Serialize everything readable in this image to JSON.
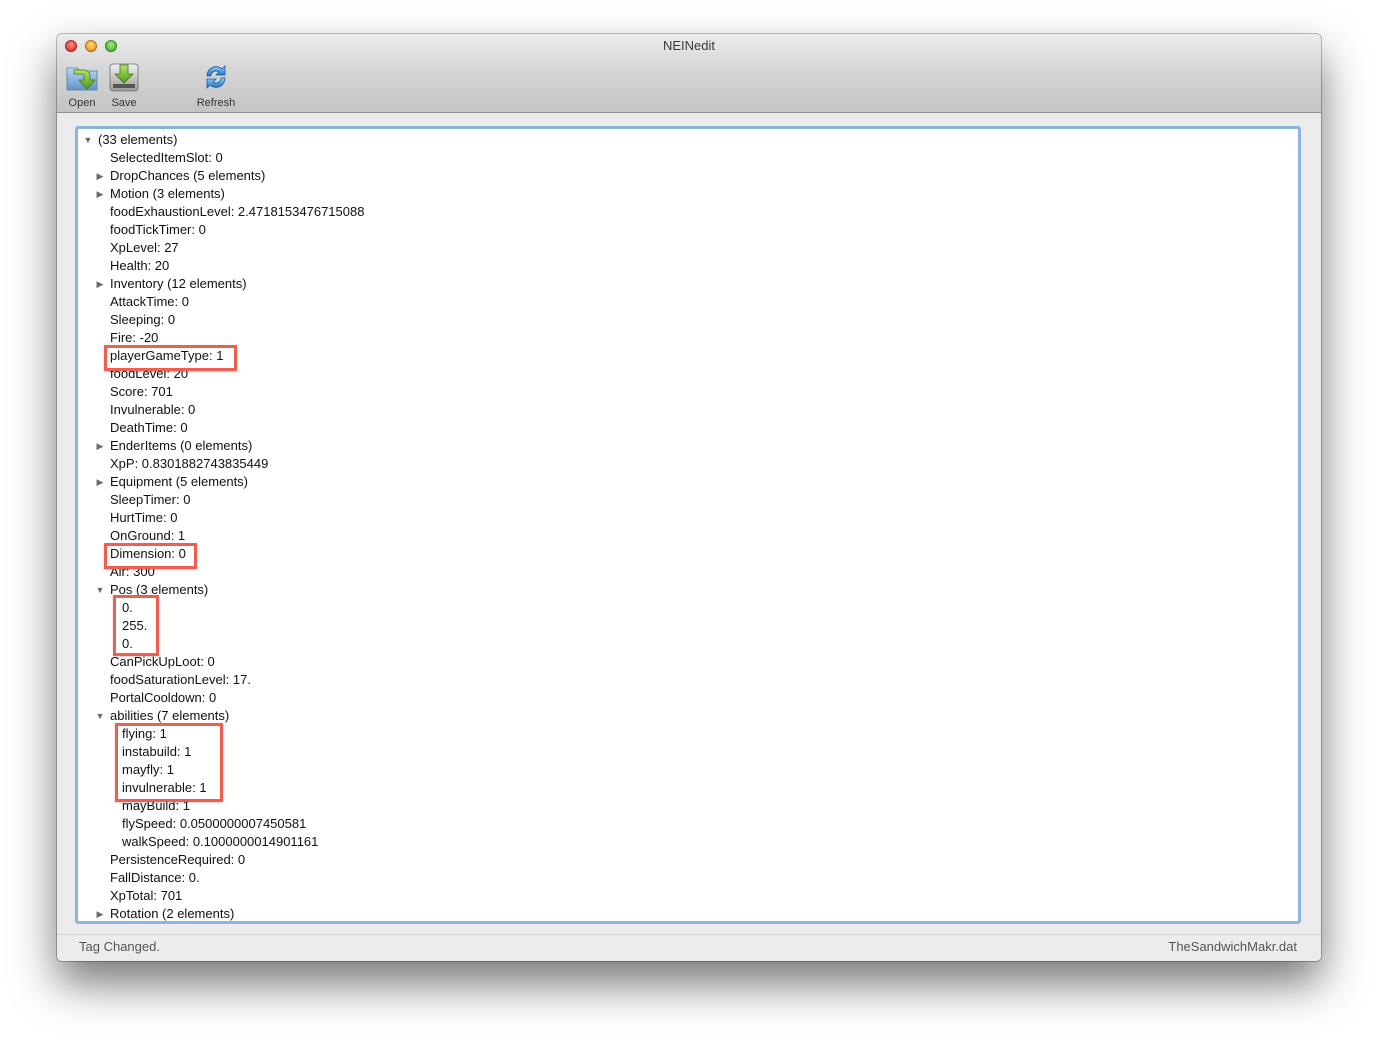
{
  "window": {
    "title": "NEINedit"
  },
  "toolbar": {
    "open_label": "Open",
    "save_label": "Save",
    "refresh_label": "Refresh"
  },
  "tree": {
    "root": {
      "label": "(33 elements)",
      "expanded": true
    },
    "items": [
      {
        "label": "SelectedItemSlot: 0",
        "level": 1
      },
      {
        "label": "DropChances (5 elements)",
        "level": 1,
        "expandable": true,
        "expanded": false
      },
      {
        "label": "Motion (3 elements)",
        "level": 1,
        "expandable": true,
        "expanded": false
      },
      {
        "label": "foodExhaustionLevel: 2.4718153476715088",
        "level": 1
      },
      {
        "label": "foodTickTimer: 0",
        "level": 1
      },
      {
        "label": "XpLevel: 27",
        "level": 1
      },
      {
        "label": "Health: 20",
        "level": 1
      },
      {
        "label": "Inventory (12 elements)",
        "level": 1,
        "expandable": true,
        "expanded": false
      },
      {
        "label": "AttackTime: 0",
        "level": 1
      },
      {
        "label": "Sleeping: 0",
        "level": 1
      },
      {
        "label": "Fire: -20",
        "level": 1
      },
      {
        "label": "playerGameType: 1",
        "level": 1,
        "highlighted": true
      },
      {
        "label": "foodLevel: 20",
        "level": 1
      },
      {
        "label": "Score: 701",
        "level": 1
      },
      {
        "label": "Invulnerable: 0",
        "level": 1
      },
      {
        "label": "DeathTime: 0",
        "level": 1
      },
      {
        "label": "EnderItems (0 elements)",
        "level": 1,
        "expandable": true,
        "expanded": false
      },
      {
        "label": "XpP: 0.8301882743835449",
        "level": 1
      },
      {
        "label": "Equipment (5 elements)",
        "level": 1,
        "expandable": true,
        "expanded": false
      },
      {
        "label": "SleepTimer: 0",
        "level": 1
      },
      {
        "label": "HurtTime: 0",
        "level": 1
      },
      {
        "label": "OnGround: 1",
        "level": 1
      },
      {
        "label": "Dimension: 0",
        "level": 1,
        "highlighted": true
      },
      {
        "label": "Air: 300",
        "level": 1
      },
      {
        "label": "Pos (3 elements)",
        "level": 1,
        "expandable": true,
        "expanded": true
      },
      {
        "label": "0.",
        "level": 2,
        "highlighted": true
      },
      {
        "label": "255.",
        "level": 2,
        "highlighted": true
      },
      {
        "label": "0.",
        "level": 2,
        "highlighted": true
      },
      {
        "label": "CanPickUpLoot: 0",
        "level": 1
      },
      {
        "label": "foodSaturationLevel: 17.",
        "level": 1
      },
      {
        "label": "PortalCooldown: 0",
        "level": 1
      },
      {
        "label": "abilities (7 elements)",
        "level": 1,
        "expandable": true,
        "expanded": true
      },
      {
        "label": "flying: 1",
        "level": 2,
        "highlighted": true
      },
      {
        "label": "instabuild: 1",
        "level": 2,
        "highlighted": true
      },
      {
        "label": "mayfly: 1",
        "level": 2,
        "highlighted": true
      },
      {
        "label": "invulnerable: 1",
        "level": 2,
        "highlighted": true
      },
      {
        "label": "mayBuild: 1",
        "level": 2
      },
      {
        "label": "flySpeed: 0.0500000007450581",
        "level": 2
      },
      {
        "label": "walkSpeed: 0.1000000014901161",
        "level": 2
      },
      {
        "label": "PersistenceRequired: 0",
        "level": 1
      },
      {
        "label": "FallDistance: 0.",
        "level": 1
      },
      {
        "label": "XpTotal: 701",
        "level": 1
      },
      {
        "label": "Rotation (2 elements)",
        "level": 1,
        "expandable": true,
        "expanded": false
      }
    ]
  },
  "status": {
    "message": "Tag Changed.",
    "filename": "TheSandwichMakr.dat"
  },
  "colors": {
    "highlight": "#ef5e51",
    "focus_ring": "#8db4e0"
  }
}
